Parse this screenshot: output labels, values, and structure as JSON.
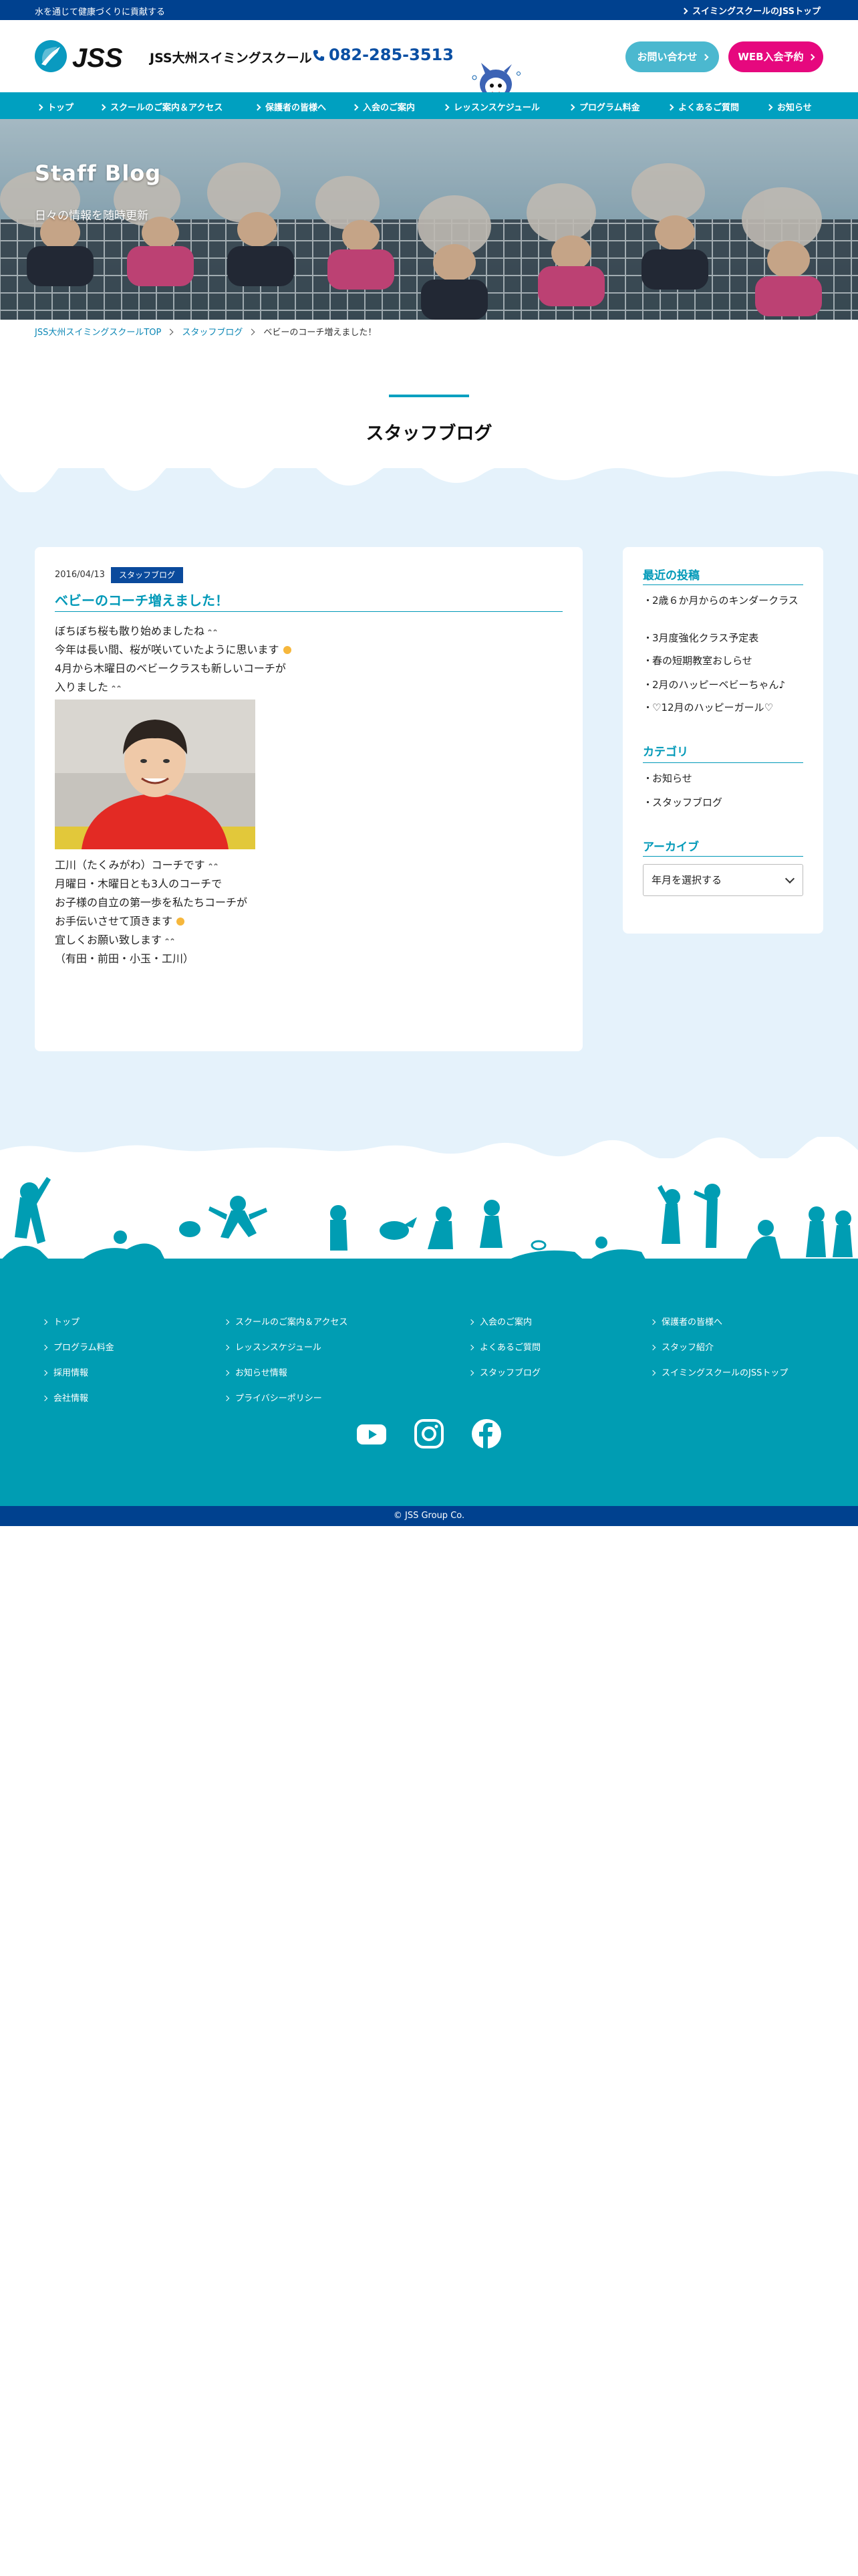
{
  "topbar": {
    "tagline": "水を通じて健康づくりに貢献する",
    "top_link": "スイミングスクールのJSSトップ"
  },
  "header": {
    "logo_text": "JSS",
    "school_name": "JSS大州スイミングスクール",
    "phone": "082-285-3513",
    "contact_label": "お問い合わせ",
    "web_label": "WEB入会予約"
  },
  "nav": {
    "items": [
      {
        "label": "トップ"
      },
      {
        "label": "スクールのご案内＆アクセス"
      },
      {
        "label": "保護者の皆様へ"
      },
      {
        "label": "入会のご案内"
      },
      {
        "label": "レッスンスケジュール"
      },
      {
        "label": "プログラム料金"
      },
      {
        "label": "よくあるご質問"
      },
      {
        "label": "お知らせ"
      }
    ]
  },
  "hero": {
    "title": "Staff Blog",
    "subtitle": "日々の情報を随時更新"
  },
  "breadcrumb": {
    "home": "JSS大州スイミングスクールTOP",
    "category": "スタッフブログ",
    "current": "ベビーのコーチ増えました！"
  },
  "section": {
    "title": "スタッフブログ"
  },
  "post": {
    "date": "2016/04/13",
    "category": "スタッフブログ",
    "title": "ベビーのコーチ増えました！",
    "lines_before": [
      "ぼちぼち桜も散り始めましたね",
      "今年は長い間、桜が咲いていたように思います",
      "4月から木曜日のベビークラスも新しいコーチが",
      "入りました"
    ],
    "lines_after": [
      "工川（たくみがわ）コーチです",
      "月曜日・木曜日とも3人のコーチで",
      "お子様の自立の第一歩を私たちコーチが",
      "お手伝いさせて頂きます",
      "宜しくお願い致します",
      "（有田・前田・小玉・工川）"
    ]
  },
  "sidebar": {
    "recent_heading": "最近の投稿",
    "recent": [
      {
        "label": "2歳６か月からのキンダークラス"
      },
      {
        "label": "3月度強化クラス予定表"
      },
      {
        "label": "春の短期教室おしらせ"
      },
      {
        "label": "2月のハッピーベビーちゃん♪"
      },
      {
        "label": "♡12月のハッピーガール♡"
      }
    ],
    "category_heading": "カテゴリ",
    "categories": [
      {
        "label": "お知らせ"
      },
      {
        "label": "スタッフブログ"
      }
    ],
    "archive_heading": "アーカイブ",
    "archive_select": "年月を選択する",
    "bullet": "・"
  },
  "footer": {
    "col1": [
      {
        "label": "トップ"
      },
      {
        "label": "プログラム料金"
      },
      {
        "label": "採用情報"
      },
      {
        "label": "会社情報"
      }
    ],
    "col2": [
      {
        "label": "スクールのご案内＆アクセス"
      },
      {
        "label": "レッスンスケジュール"
      },
      {
        "label": "お知らせ情報"
      },
      {
        "label": "プライバシーポリシー"
      }
    ],
    "col3": [
      {
        "label": "入会のご案内"
      },
      {
        "label": "よくあるご質問"
      },
      {
        "label": "スタッフブログ"
      }
    ],
    "col4": [
      {
        "label": "保護者の皆様へ"
      },
      {
        "label": "スタッフ紹介"
      },
      {
        "label": "スイミングスクールのJSSトップ"
      }
    ],
    "social": [
      "youtube-icon",
      "instagram-icon",
      "facebook-icon"
    ],
    "copyright": "© JSS Group Co."
  },
  "colors": {
    "brand_navy": "#00418f",
    "brand_teal": "#00a0c0",
    "accent_pink": "#e6087e",
    "content_bg": "#e5f2fb"
  }
}
